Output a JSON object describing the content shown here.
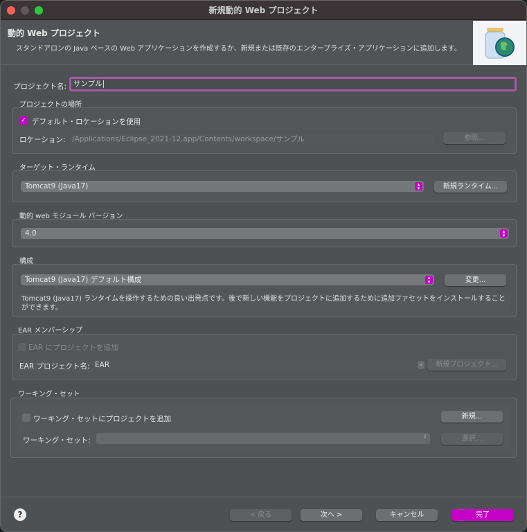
{
  "window": {
    "title": "新規動的 Web プロジェクト"
  },
  "header": {
    "title": "動的 Web プロジェクト",
    "description": "スタンドアロンの Java ベースの Web アプリケーションを作成するか、新規または既存のエンタープライズ・アプリケーションに追加します。"
  },
  "project_name": {
    "label": "プロジェクト名:",
    "value": "サンプル"
  },
  "location": {
    "group": "プロジェクトの場所",
    "use_default": "デフォルト・ロケーションを使用",
    "use_default_checked": true,
    "label": "ロケーション:",
    "value": "/Applications/Eclipse_2021-12.app/Contents/workspace/サンプル",
    "browse": "参照..."
  },
  "runtime": {
    "group": "ターゲット・ランタイム",
    "value": "Tomcat9 (Java17)",
    "new_button": "新規ランタイム..."
  },
  "module": {
    "group": "動的 web モジュール バージョン",
    "value": "4.0"
  },
  "config": {
    "group": "構成",
    "value": "Tomcat9 (Java17) デフォルト構成",
    "modify": "変更...",
    "description": "Tomcat9 (Java17) ランタイムを操作するための良い出発点です。後で新しい機能をプロジェクトに追加するために追加ファセットをインストールすることができます。"
  },
  "ear": {
    "group": "EAR メンバーシップ",
    "add": "EAR にプロジェクトを追加",
    "name_label": "EAR プロジェクト名:",
    "name_value": "EAR",
    "new_project": "新規プロジェクト..."
  },
  "working_set": {
    "group": "ワーキング・セット",
    "add": "ワーキング・セットにプロジェクトを追加",
    "new": "新規...",
    "label": "ワーキング・セット:",
    "select": "選択..."
  },
  "footer": {
    "back": "< 戻る",
    "next": "次へ >",
    "cancel": "キャンセル",
    "finish": "完了",
    "help": "?"
  },
  "colors": {
    "accent": "#c700c7",
    "focus": "#a35ba3"
  }
}
